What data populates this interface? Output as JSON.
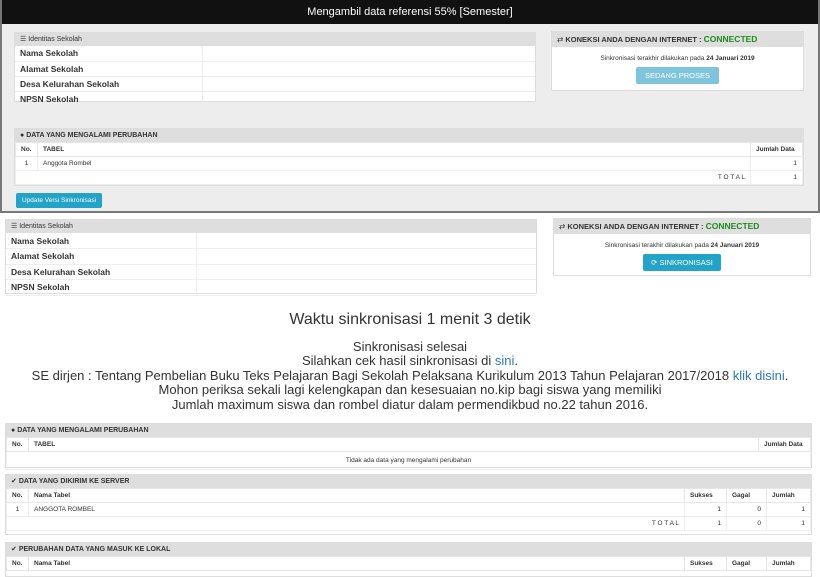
{
  "modal": {
    "header": "Mengambil data referensi 55% [Semester]",
    "identity_title": "Identitas Sekolah",
    "identity_rows": [
      "Nama Sekolah",
      "Alamat Sekolah",
      "Desa Kelurahan Sekolah",
      "NPSN Sekolah"
    ],
    "conn_label": "KONEKSI ANDA DENGAN INTERNET :",
    "conn_status": "CONNECTED",
    "sync_text": "Sinkronisasi terakhir dilakukan pada",
    "sync_date": "24 Januari 2019",
    "proses_button": "SEDANG PROSES",
    "changes": {
      "title": "DATA YANG MENGALAMI PERUBAHAN",
      "col_no": "No.",
      "col_tabel": "TABEL",
      "col_jumlah": "Jumlah Data",
      "rows": [
        {
          "no": "1",
          "tabel": "Anggota Rombel",
          "jumlah": "1"
        }
      ],
      "total_label": "T O T A L",
      "total": "1"
    },
    "update_button": "Update Versi Sinkronisasi"
  },
  "main": {
    "identity_title": "Identitas Sekolah",
    "identity_rows": [
      "Nama Sekolah",
      "Alamat Sekolah",
      "Desa Kelurahan Sekolah",
      "NPSN Sekolah"
    ],
    "conn_label": "KONEKSI ANDA DENGAN INTERNET :",
    "conn_status": "CONNECTED",
    "sync_text": "Sinkronisasi terakhir dilakukan pada",
    "sync_date": "24 Januari 2019",
    "sync_button": "SINKRONISASI",
    "sync_time": "Waktu sinkronisasi 1 menit 3 detik",
    "message": {
      "line1": "Sinkronisasi selesai",
      "line2_pre": "Silahkan cek hasil sinkronisasi di",
      "line2_link": "sini",
      "line2_post": ".",
      "line3_pre": "SE dirjen : Tentang Pembelian Buku Teks Pelajaran Bagi Sekolah Pelaksana Kurikulum 2013 Tahun Pelajaran 2017/2018",
      "line3_link": "klik disini",
      "line3_post": ".",
      "line4": "Mohon periksa sekali lagi kelengkapan dan kesesuaian no.kip bagi siswa yang memiliki",
      "line5": "Jumlah maximum siswa dan rombel diatur dalam permendikbud no.22 tahun 2016."
    },
    "changes": {
      "title": "DATA YANG MENGALAMI PERUBAHAN",
      "col_no": "No.",
      "col_tabel": "TABEL",
      "col_jumlah": "Jumlah Data",
      "empty": "Tidak ada data yang mengalami perubahan"
    },
    "sent": {
      "title": "DATA YANG DIKIRIM KE SERVER",
      "col_no": "No.",
      "col_nama": "Nama Tabel",
      "col_sukses": "Sukses",
      "col_gagal": "Gagal",
      "col_jumlah": "Jumlah",
      "rows": [
        {
          "no": "1",
          "nama": "ANGGOTA ROMBEL",
          "sukses": "1",
          "gagal": "0",
          "jumlah": "1"
        }
      ],
      "total_label": "T O T A L",
      "total_sukses": "1",
      "total_gagal": "0",
      "total_jumlah": "1"
    },
    "local": {
      "title": "PERUBAHAN DATA YANG MASUK KE LOKAL",
      "col_no": "No.",
      "col_nama": "Nama Tabel",
      "col_sukses": "Sukses",
      "col_gagal": "Gagal",
      "col_jumlah": "Jumlah"
    }
  }
}
